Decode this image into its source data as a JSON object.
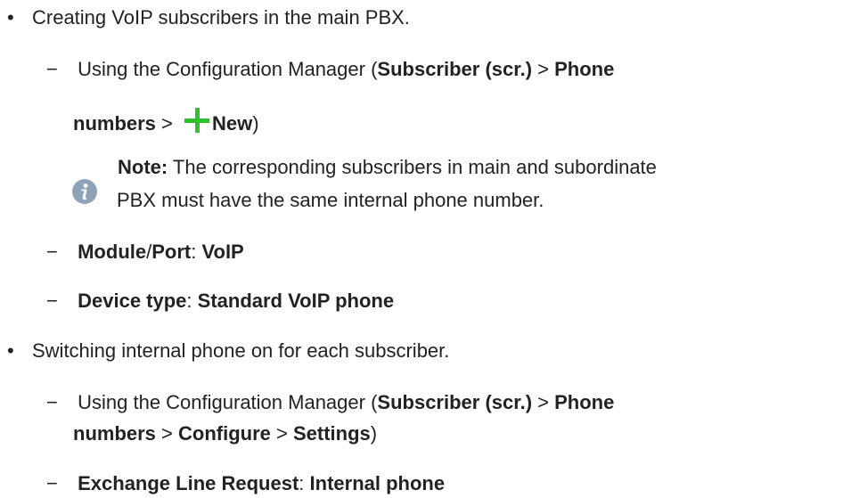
{
  "bullet_char": "•",
  "dash_char": "−",
  "item1": {
    "text": "Creating VoIP subscribers in the main PBX."
  },
  "sub1": {
    "prefix": "Using the Configuration Manager (",
    "subscriber": "Subscriber (scr.)",
    "gt1": " > ",
    "phone": "Phone",
    "numbers": "numbers",
    "gt2": " > ",
    "new": "New",
    "close": ")"
  },
  "note": {
    "label": "Note:",
    "line1": " The corresponding subscribers in main and subordinate",
    "line2": "PBX must have the same internal phone number."
  },
  "sub2": {
    "module": "Module",
    "slash": "/",
    "port": "Port",
    "colon": ": ",
    "voip": "VoIP"
  },
  "sub3": {
    "device": "Device type",
    "colon": ": ",
    "value": "Standard VoIP phone"
  },
  "item2": {
    "text": "Switching internal phone on for each subscriber."
  },
  "sub4": {
    "prefix": "Using the Configuration Manager (",
    "subscriber": "Subscriber (scr.)",
    "gt1": " > ",
    "phone": "Phone",
    "numbers": "numbers",
    "gt2": " > ",
    "configure": "Configure",
    "gt3": " > ",
    "settings": "Settings",
    "close": ")"
  },
  "sub5": {
    "label": "Exchange Line Request",
    "colon": ": ",
    "value": "Internal phone"
  },
  "colors": {
    "text": "#222222",
    "plus_icon": "#2fbf2f",
    "info_icon": "#8fa3b8"
  }
}
